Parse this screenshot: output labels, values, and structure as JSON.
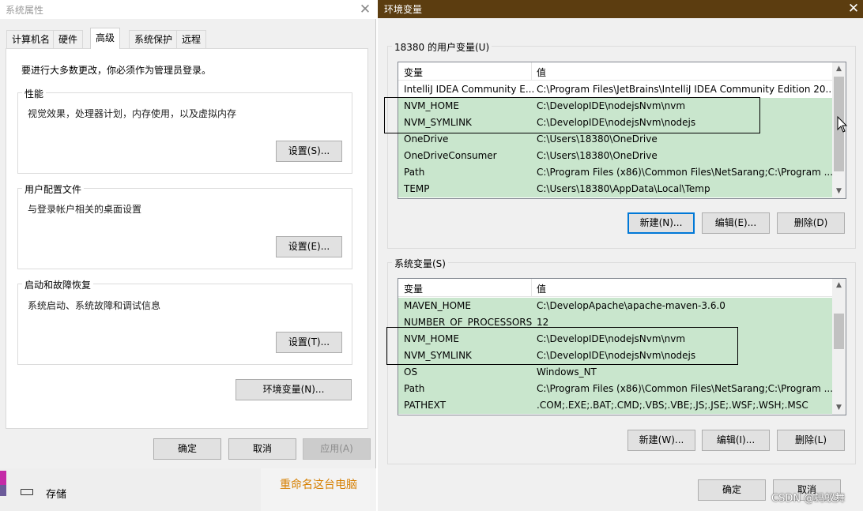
{
  "system_properties": {
    "title": "系统属性",
    "close_glyph": "✕",
    "tabs": [
      {
        "label": "计算机名",
        "active": false
      },
      {
        "label": "硬件",
        "active": false
      },
      {
        "label": "高级",
        "active": true
      },
      {
        "label": "系统保护",
        "active": false
      },
      {
        "label": "远程",
        "active": false
      }
    ],
    "admin_notice": "要进行大多数更改，你必须作为管理员登录。",
    "groups": [
      {
        "title": "性能",
        "description": "视觉效果，处理器计划，内存使用，以及虚拟内存",
        "button": "设置(S)..."
      },
      {
        "title": "用户配置文件",
        "description": "与登录帐户相关的桌面设置",
        "button": "设置(E)..."
      },
      {
        "title": "启动和故障恢复",
        "description": "系统启动、系统故障和调试信息",
        "button": "设置(T)..."
      }
    ],
    "env_button": "环境变量(N)...",
    "ok_button": "确定",
    "cancel_button": "取消",
    "apply_button": "应用(A)"
  },
  "background": {
    "storage_icon": "drive-icon",
    "storage_label": "存储",
    "rename_link": "重命名这台电脑"
  },
  "env_vars": {
    "title": "环境变量",
    "close_glyph": "✕",
    "user_section": {
      "legend": "18380 的用户变量(U)",
      "col_var": "变量",
      "col_val": "值",
      "rows": [
        {
          "name": "IntelliJ IDEA Community E...",
          "value": "C:\\Program Files\\JetBrains\\IntelliJ IDEA Community Edition 20..."
        },
        {
          "name": "NVM_HOME",
          "value": "C:\\DevelopIDE\\nodejsNvm\\nvm"
        },
        {
          "name": "NVM_SYMLINK",
          "value": "C:\\DevelopIDE\\nodejsNvm\\nodejs"
        },
        {
          "name": "OneDrive",
          "value": "C:\\Users\\18380\\OneDrive"
        },
        {
          "name": "OneDriveConsumer",
          "value": "C:\\Users\\18380\\OneDrive"
        },
        {
          "name": "Path",
          "value": "C:\\Program Files (x86)\\Common Files\\NetSarang;C:\\Program ..."
        },
        {
          "name": "TEMP",
          "value": "C:\\Users\\18380\\AppData\\Local\\Temp"
        }
      ],
      "new_button": "新建(N)...",
      "edit_button": "编辑(E)...",
      "delete_button": "删除(D)"
    },
    "system_section": {
      "legend": "系统变量(S)",
      "col_var": "变量",
      "col_val": "值",
      "rows": [
        {
          "name": "MAVEN_HOME",
          "value": "C:\\DevelopApache\\apache-maven-3.6.0"
        },
        {
          "name": "NUMBER_OF_PROCESSORS",
          "value": "12"
        },
        {
          "name": "NVM_HOME",
          "value": "C:\\DevelopIDE\\nodejsNvm\\nvm"
        },
        {
          "name": "NVM_SYMLINK",
          "value": "C:\\DevelopIDE\\nodejsNvm\\nodejs"
        },
        {
          "name": "OS",
          "value": "Windows_NT"
        },
        {
          "name": "Path",
          "value": "C:\\Program Files (x86)\\Common Files\\NetSarang;C:\\Program ..."
        },
        {
          "name": "PATHEXT",
          "value": ".COM;.EXE;.BAT;.CMD;.VBS;.VBE;.JS;.JSE;.WSF;.WSH;.MSC"
        }
      ],
      "new_button": "新建(W)...",
      "edit_button": "编辑(I)...",
      "delete_button": "删除(L)"
    },
    "ok_button": "确定",
    "cancel_button": "取消"
  },
  "watermark": "CSDN @蚂蚁舞",
  "colors": {
    "env_title_bar": "#5c3d10",
    "row_selected_bg": "#c9e6cd",
    "default_button_border": "#0078d7",
    "rename_link": "#d67f00"
  }
}
